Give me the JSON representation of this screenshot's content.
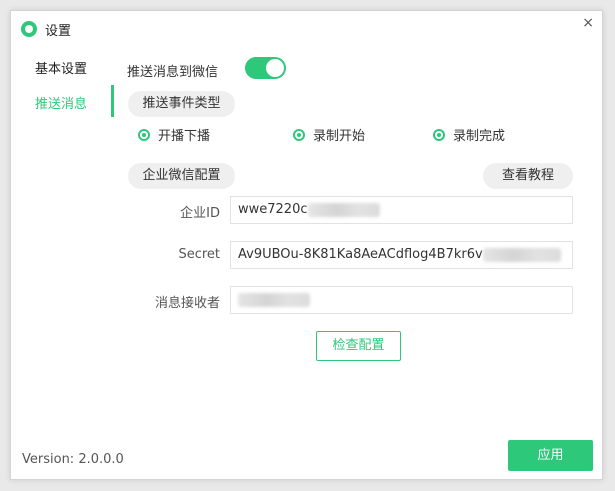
{
  "window": {
    "title": "设置",
    "close_glyph": "×"
  },
  "icons": {
    "app": "app-logo-icon",
    "close": "close-icon"
  },
  "colors": {
    "accent": "#2ec87a"
  },
  "nav": {
    "items": [
      {
        "label": "基本设置",
        "active": false
      },
      {
        "label": "推送消息",
        "active": true
      }
    ]
  },
  "push": {
    "wechat_label": "推送消息到微信",
    "wechat_enabled": true,
    "event_types_title": "推送事件类型",
    "events": [
      {
        "label": "开播下播",
        "checked": true
      },
      {
        "label": "录制开始",
        "checked": true
      },
      {
        "label": "录制完成",
        "checked": true
      }
    ],
    "wecom_config_title": "企业微信配置",
    "tutorial_button": "查看教程",
    "fields": {
      "corp_id": {
        "label": "企业ID",
        "value": "wwe7220c"
      },
      "secret": {
        "label": "Secret",
        "value": "Av9UBOu-8K81Ka8AeACdflog4B7kr6v"
      },
      "receiver": {
        "label": "消息接收者",
        "value": ""
      }
    },
    "check_button": "检查配置"
  },
  "footer": {
    "version_label": "Version:",
    "version_value": "2.0.0.0",
    "apply_button": "应用"
  }
}
